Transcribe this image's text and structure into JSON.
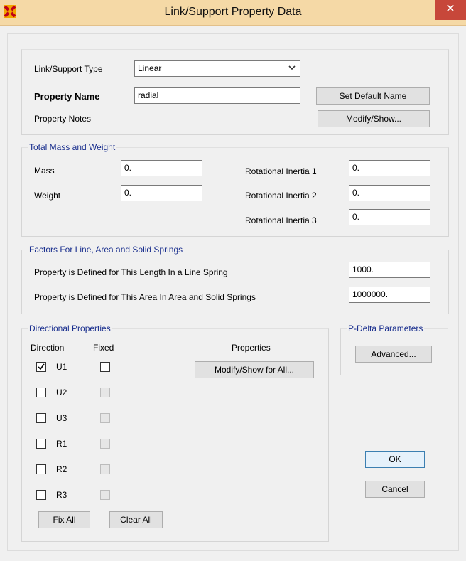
{
  "window": {
    "title": "Link/Support Property Data",
    "close_glyph": "✕"
  },
  "general": {
    "type_label": "Link/Support Type",
    "type_value": "Linear",
    "name_label": "Property Name",
    "name_value": "radial",
    "notes_label": "Property Notes",
    "set_default_label": "Set Default Name",
    "modify_show_label": "Modify/Show..."
  },
  "mass": {
    "legend": "Total Mass and Weight",
    "mass_label": "Mass",
    "mass_value": "0.",
    "weight_label": "Weight",
    "weight_value": "0.",
    "ri1_label": "Rotational Inertia 1",
    "ri1_value": "0.",
    "ri2_label": "Rotational Inertia 2",
    "ri2_value": "0.",
    "ri3_label": "Rotational Inertia 3",
    "ri3_value": "0."
  },
  "factors": {
    "legend": "Factors For Line, Area and Solid Springs",
    "length_label": "Property is Defined for This Length In a Line Spring",
    "length_value": "1000.",
    "area_label": "Property is Defined for This Area In Area and Solid Springs",
    "area_value": "1000000."
  },
  "directional": {
    "legend": "Directional Properties",
    "col_direction": "Direction",
    "col_fixed": "Fixed",
    "col_properties": "Properties",
    "modify_all_label": "Modify/Show for All...",
    "rows": [
      {
        "name": "U1",
        "checked": true,
        "fixed_enabled": true
      },
      {
        "name": "U2",
        "checked": false,
        "fixed_enabled": false
      },
      {
        "name": "U3",
        "checked": false,
        "fixed_enabled": false
      },
      {
        "name": "R1",
        "checked": false,
        "fixed_enabled": false
      },
      {
        "name": "R2",
        "checked": false,
        "fixed_enabled": false
      },
      {
        "name": "R3",
        "checked": false,
        "fixed_enabled": false
      }
    ],
    "fix_all_label": "Fix All",
    "clear_all_label": "Clear All"
  },
  "pdelta": {
    "legend": "P-Delta Parameters",
    "advanced_label": "Advanced..."
  },
  "actions": {
    "ok_label": "OK",
    "cancel_label": "Cancel"
  },
  "colors": {
    "titlebar": "#f5d9a6",
    "close": "#c7473a",
    "legend_text": "#1a2f8e"
  }
}
